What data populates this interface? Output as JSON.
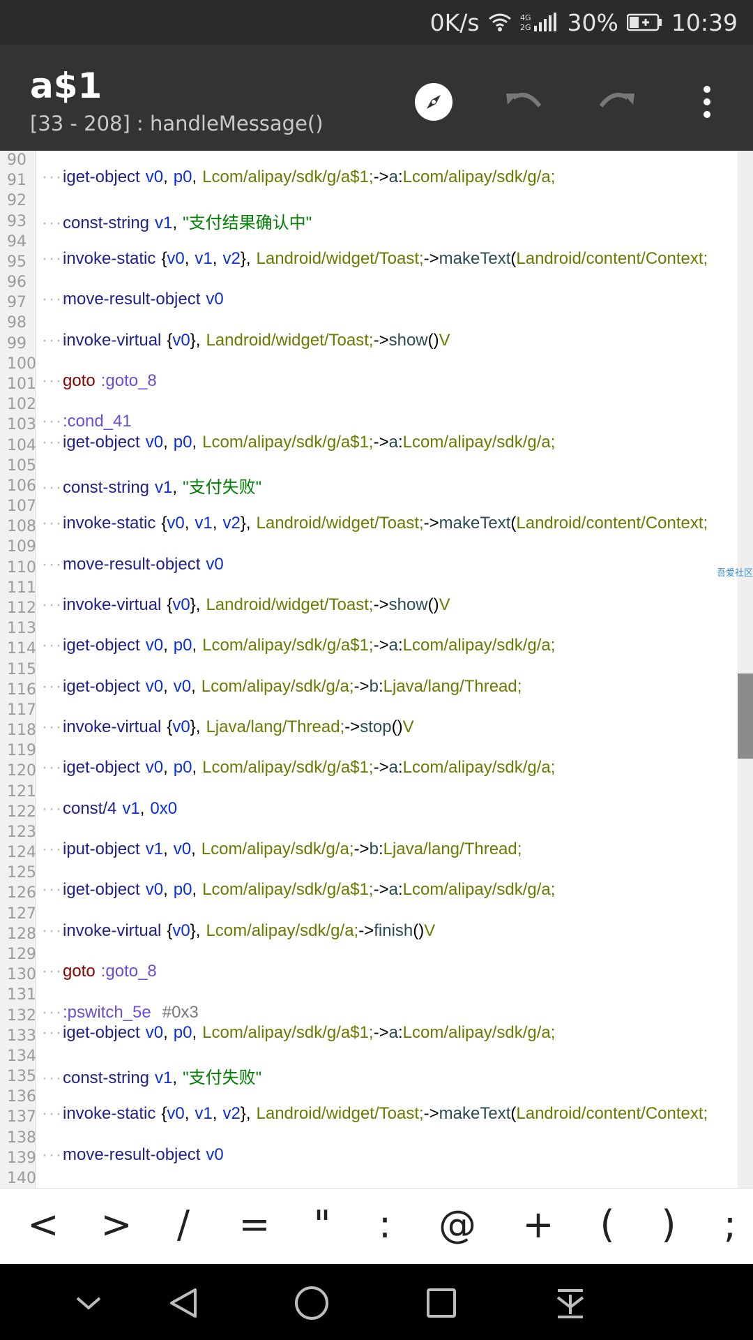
{
  "status_bar": {
    "speed": "0K/s",
    "network": "4G 2G",
    "battery_percent": "30%",
    "time": "10:39"
  },
  "app_bar": {
    "title": "a$1",
    "subtitle": "[33 - 208] : handleMessage()",
    "icons": [
      "compass-icon",
      "undo-icon",
      "redo-icon",
      "more-vert-icon"
    ]
  },
  "editor": {
    "watermark": "吾爱社区",
    "lines": [
      {
        "n": "90",
        "t": []
      },
      {
        "n": "91",
        "t": [
          [
            "kw",
            "iget-object"
          ],
          [
            "sp"
          ],
          [
            "reg",
            "v0"
          ],
          [
            "pun",
            ","
          ],
          [
            "sp"
          ],
          [
            "reg",
            "p0"
          ],
          [
            "pun",
            ","
          ],
          [
            "sp"
          ],
          [
            "cls",
            "Lcom/alipay/sdk/g/a$1;"
          ],
          [
            "pun",
            "->"
          ],
          [
            "meth",
            "a"
          ],
          [
            "pun",
            ":"
          ],
          [
            "cls",
            "Lcom/alipay/sdk/g/a;"
          ]
        ]
      },
      {
        "n": "92",
        "t": []
      },
      {
        "n": "93",
        "t": [
          [
            "kw",
            "const-string"
          ],
          [
            "sp"
          ],
          [
            "reg",
            "v1"
          ],
          [
            "pun",
            ","
          ],
          [
            "sp"
          ],
          [
            "str",
            "\"支付结果确认中\""
          ]
        ]
      },
      {
        "n": "94",
        "t": []
      },
      {
        "n": "95",
        "t": [
          [
            "kw",
            "invoke-static"
          ],
          [
            "sp"
          ],
          [
            "pun",
            "{"
          ],
          [
            "reg",
            "v0"
          ],
          [
            "pun",
            ","
          ],
          [
            "sp"
          ],
          [
            "reg",
            "v1"
          ],
          [
            "pun",
            ","
          ],
          [
            "sp"
          ],
          [
            "reg",
            "v2"
          ],
          [
            "pun",
            "},"
          ],
          [
            "sp"
          ],
          [
            "cls",
            "Landroid/widget/Toast;"
          ],
          [
            "pun",
            "->"
          ],
          [
            "meth",
            "makeText"
          ],
          [
            "pun",
            "("
          ],
          [
            "cls",
            "Landroid/content/Context;"
          ]
        ]
      },
      {
        "n": "96",
        "t": []
      },
      {
        "n": "97",
        "t": [
          [
            "kw",
            "move-result-object"
          ],
          [
            "sp"
          ],
          [
            "reg",
            "v0"
          ]
        ]
      },
      {
        "n": "98",
        "t": []
      },
      {
        "n": "99",
        "t": [
          [
            "kw",
            "invoke-virtual"
          ],
          [
            "sp"
          ],
          [
            "pun",
            "{"
          ],
          [
            "reg",
            "v0"
          ],
          [
            "pun",
            "},"
          ],
          [
            "sp"
          ],
          [
            "cls",
            "Landroid/widget/Toast;"
          ],
          [
            "pun",
            "->"
          ],
          [
            "meth",
            "show"
          ],
          [
            "pun",
            "()"
          ],
          [
            "cls",
            "V"
          ]
        ]
      },
      {
        "n": "100",
        "t": []
      },
      {
        "n": "101",
        "t": [
          [
            "kwred",
            "goto"
          ],
          [
            "sp"
          ],
          [
            "lbl",
            ":goto_8"
          ]
        ]
      },
      {
        "n": "102",
        "t": []
      },
      {
        "n": "103",
        "t": [
          [
            "lbl",
            ":cond_41"
          ]
        ]
      },
      {
        "n": "104",
        "t": [
          [
            "kw",
            "iget-object"
          ],
          [
            "sp"
          ],
          [
            "reg",
            "v0"
          ],
          [
            "pun",
            ","
          ],
          [
            "sp"
          ],
          [
            "reg",
            "p0"
          ],
          [
            "pun",
            ","
          ],
          [
            "sp"
          ],
          [
            "cls",
            "Lcom/alipay/sdk/g/a$1;"
          ],
          [
            "pun",
            "->"
          ],
          [
            "meth",
            "a"
          ],
          [
            "pun",
            ":"
          ],
          [
            "cls",
            "Lcom/alipay/sdk/g/a;"
          ]
        ]
      },
      {
        "n": "105",
        "t": []
      },
      {
        "n": "106",
        "t": [
          [
            "kw",
            "const-string"
          ],
          [
            "sp"
          ],
          [
            "reg",
            "v1"
          ],
          [
            "pun",
            ","
          ],
          [
            "sp"
          ],
          [
            "str",
            "\"支付失败\""
          ]
        ]
      },
      {
        "n": "107",
        "t": []
      },
      {
        "n": "108",
        "t": [
          [
            "kw",
            "invoke-static"
          ],
          [
            "sp"
          ],
          [
            "pun",
            "{"
          ],
          [
            "reg",
            "v0"
          ],
          [
            "pun",
            ","
          ],
          [
            "sp"
          ],
          [
            "reg",
            "v1"
          ],
          [
            "pun",
            ","
          ],
          [
            "sp"
          ],
          [
            "reg",
            "v2"
          ],
          [
            "pun",
            "},"
          ],
          [
            "sp"
          ],
          [
            "cls",
            "Landroid/widget/Toast;"
          ],
          [
            "pun",
            "->"
          ],
          [
            "meth",
            "makeText"
          ],
          [
            "pun",
            "("
          ],
          [
            "cls",
            "Landroid/content/Context;"
          ]
        ]
      },
      {
        "n": "109",
        "t": []
      },
      {
        "n": "110",
        "t": [
          [
            "kw",
            "move-result-object"
          ],
          [
            "sp"
          ],
          [
            "reg",
            "v0"
          ]
        ]
      },
      {
        "n": "111",
        "t": []
      },
      {
        "n": "112",
        "t": [
          [
            "kw",
            "invoke-virtual"
          ],
          [
            "sp"
          ],
          [
            "pun",
            "{"
          ],
          [
            "reg",
            "v0"
          ],
          [
            "pun",
            "},"
          ],
          [
            "sp"
          ],
          [
            "cls",
            "Landroid/widget/Toast;"
          ],
          [
            "pun",
            "->"
          ],
          [
            "meth",
            "show"
          ],
          [
            "pun",
            "()"
          ],
          [
            "cls",
            "V"
          ]
        ]
      },
      {
        "n": "113",
        "t": []
      },
      {
        "n": "114",
        "t": [
          [
            "kw",
            "iget-object"
          ],
          [
            "sp"
          ],
          [
            "reg",
            "v0"
          ],
          [
            "pun",
            ","
          ],
          [
            "sp"
          ],
          [
            "reg",
            "p0"
          ],
          [
            "pun",
            ","
          ],
          [
            "sp"
          ],
          [
            "cls",
            "Lcom/alipay/sdk/g/a$1;"
          ],
          [
            "pun",
            "->"
          ],
          [
            "meth",
            "a"
          ],
          [
            "pun",
            ":"
          ],
          [
            "cls",
            "Lcom/alipay/sdk/g/a;"
          ]
        ]
      },
      {
        "n": "115",
        "t": []
      },
      {
        "n": "116",
        "t": [
          [
            "kw",
            "iget-object"
          ],
          [
            "sp"
          ],
          [
            "reg",
            "v0"
          ],
          [
            "pun",
            ","
          ],
          [
            "sp"
          ],
          [
            "reg",
            "v0"
          ],
          [
            "pun",
            ","
          ],
          [
            "sp"
          ],
          [
            "cls",
            "Lcom/alipay/sdk/g/a;"
          ],
          [
            "pun",
            "->"
          ],
          [
            "meth",
            "b"
          ],
          [
            "pun",
            ":"
          ],
          [
            "cls",
            "Ljava/lang/Thread;"
          ]
        ]
      },
      {
        "n": "117",
        "t": []
      },
      {
        "n": "118",
        "t": [
          [
            "kw",
            "invoke-virtual"
          ],
          [
            "sp"
          ],
          [
            "pun",
            "{"
          ],
          [
            "reg",
            "v0"
          ],
          [
            "pun",
            "},"
          ],
          [
            "sp"
          ],
          [
            "cls",
            "Ljava/lang/Thread;"
          ],
          [
            "pun",
            "->"
          ],
          [
            "meth",
            "stop"
          ],
          [
            "pun",
            "()"
          ],
          [
            "cls",
            "V"
          ]
        ]
      },
      {
        "n": "119",
        "t": []
      },
      {
        "n": "120",
        "t": [
          [
            "kw",
            "iget-object"
          ],
          [
            "sp"
          ],
          [
            "reg",
            "v0"
          ],
          [
            "pun",
            ","
          ],
          [
            "sp"
          ],
          [
            "reg",
            "p0"
          ],
          [
            "pun",
            ","
          ],
          [
            "sp"
          ],
          [
            "cls",
            "Lcom/alipay/sdk/g/a$1;"
          ],
          [
            "pun",
            "->"
          ],
          [
            "meth",
            "a"
          ],
          [
            "pun",
            ":"
          ],
          [
            "cls",
            "Lcom/alipay/sdk/g/a;"
          ]
        ]
      },
      {
        "n": "121",
        "t": []
      },
      {
        "n": "122",
        "t": [
          [
            "kw",
            "const/4"
          ],
          [
            "sp"
          ],
          [
            "reg",
            "v1"
          ],
          [
            "pun",
            ","
          ],
          [
            "sp"
          ],
          [
            "reg",
            "0x0"
          ]
        ]
      },
      {
        "n": "123",
        "t": []
      },
      {
        "n": "124",
        "t": [
          [
            "kw",
            "iput-object"
          ],
          [
            "sp"
          ],
          [
            "reg",
            "v1"
          ],
          [
            "pun",
            ","
          ],
          [
            "sp"
          ],
          [
            "reg",
            "v0"
          ],
          [
            "pun",
            ","
          ],
          [
            "sp"
          ],
          [
            "cls",
            "Lcom/alipay/sdk/g/a;"
          ],
          [
            "pun",
            "->"
          ],
          [
            "meth",
            "b"
          ],
          [
            "pun",
            ":"
          ],
          [
            "cls",
            "Ljava/lang/Thread;"
          ]
        ]
      },
      {
        "n": "125",
        "t": []
      },
      {
        "n": "126",
        "t": [
          [
            "kw",
            "iget-object"
          ],
          [
            "sp"
          ],
          [
            "reg",
            "v0"
          ],
          [
            "pun",
            ","
          ],
          [
            "sp"
          ],
          [
            "reg",
            "p0"
          ],
          [
            "pun",
            ","
          ],
          [
            "sp"
          ],
          [
            "cls",
            "Lcom/alipay/sdk/g/a$1;"
          ],
          [
            "pun",
            "->"
          ],
          [
            "meth",
            "a"
          ],
          [
            "pun",
            ":"
          ],
          [
            "cls",
            "Lcom/alipay/sdk/g/a;"
          ]
        ]
      },
      {
        "n": "127",
        "t": []
      },
      {
        "n": "128",
        "t": [
          [
            "kw",
            "invoke-virtual"
          ],
          [
            "sp"
          ],
          [
            "pun",
            "{"
          ],
          [
            "reg",
            "v0"
          ],
          [
            "pun",
            "},"
          ],
          [
            "sp"
          ],
          [
            "cls",
            "Lcom/alipay/sdk/g/a;"
          ],
          [
            "pun",
            "->"
          ],
          [
            "meth",
            "finish"
          ],
          [
            "pun",
            "()"
          ],
          [
            "cls",
            "V"
          ]
        ]
      },
      {
        "n": "129",
        "t": []
      },
      {
        "n": "130",
        "t": [
          [
            "kwred",
            "goto"
          ],
          [
            "sp"
          ],
          [
            "lbl",
            ":goto_8"
          ]
        ]
      },
      {
        "n": "131",
        "t": []
      },
      {
        "n": "132",
        "t": [
          [
            "lbl",
            ":pswitch_5e"
          ],
          [
            "sp"
          ],
          [
            "sp"
          ],
          [
            "cmt",
            "#0x3"
          ]
        ]
      },
      {
        "n": "133",
        "t": [
          [
            "kw",
            "iget-object"
          ],
          [
            "sp"
          ],
          [
            "reg",
            "v0"
          ],
          [
            "pun",
            ","
          ],
          [
            "sp"
          ],
          [
            "reg",
            "p0"
          ],
          [
            "pun",
            ","
          ],
          [
            "sp"
          ],
          [
            "cls",
            "Lcom/alipay/sdk/g/a$1;"
          ],
          [
            "pun",
            "->"
          ],
          [
            "meth",
            "a"
          ],
          [
            "pun",
            ":"
          ],
          [
            "cls",
            "Lcom/alipay/sdk/g/a;"
          ]
        ]
      },
      {
        "n": "134",
        "t": []
      },
      {
        "n": "135",
        "t": [
          [
            "kw",
            "const-string"
          ],
          [
            "sp"
          ],
          [
            "reg",
            "v1"
          ],
          [
            "pun",
            ","
          ],
          [
            "sp"
          ],
          [
            "str",
            "\"支付失败\""
          ]
        ]
      },
      {
        "n": "136",
        "t": []
      },
      {
        "n": "137",
        "t": [
          [
            "kw",
            "invoke-static"
          ],
          [
            "sp"
          ],
          [
            "pun",
            "{"
          ],
          [
            "reg",
            "v0"
          ],
          [
            "pun",
            ","
          ],
          [
            "sp"
          ],
          [
            "reg",
            "v1"
          ],
          [
            "pun",
            ","
          ],
          [
            "sp"
          ],
          [
            "reg",
            "v2"
          ],
          [
            "pun",
            "},"
          ],
          [
            "sp"
          ],
          [
            "cls",
            "Landroid/widget/Toast;"
          ],
          [
            "pun",
            "->"
          ],
          [
            "meth",
            "makeText"
          ],
          [
            "pun",
            "("
          ],
          [
            "cls",
            "Landroid/content/Context;"
          ]
        ]
      },
      {
        "n": "138",
        "t": []
      },
      {
        "n": "139",
        "t": [
          [
            "kw",
            "move-result-object"
          ],
          [
            "sp"
          ],
          [
            "reg",
            "v0"
          ]
        ]
      },
      {
        "n": "140",
        "t": []
      }
    ]
  },
  "symbol_bar": {
    "symbols": [
      "<",
      ">",
      "/",
      "=",
      "\"",
      ":",
      "@",
      "+",
      "(",
      ")",
      ";"
    ]
  },
  "nav_bar": {
    "icons": [
      "collapse-icon",
      "back-icon",
      "home-icon",
      "recents-icon",
      "scroll-bottom-icon"
    ]
  }
}
